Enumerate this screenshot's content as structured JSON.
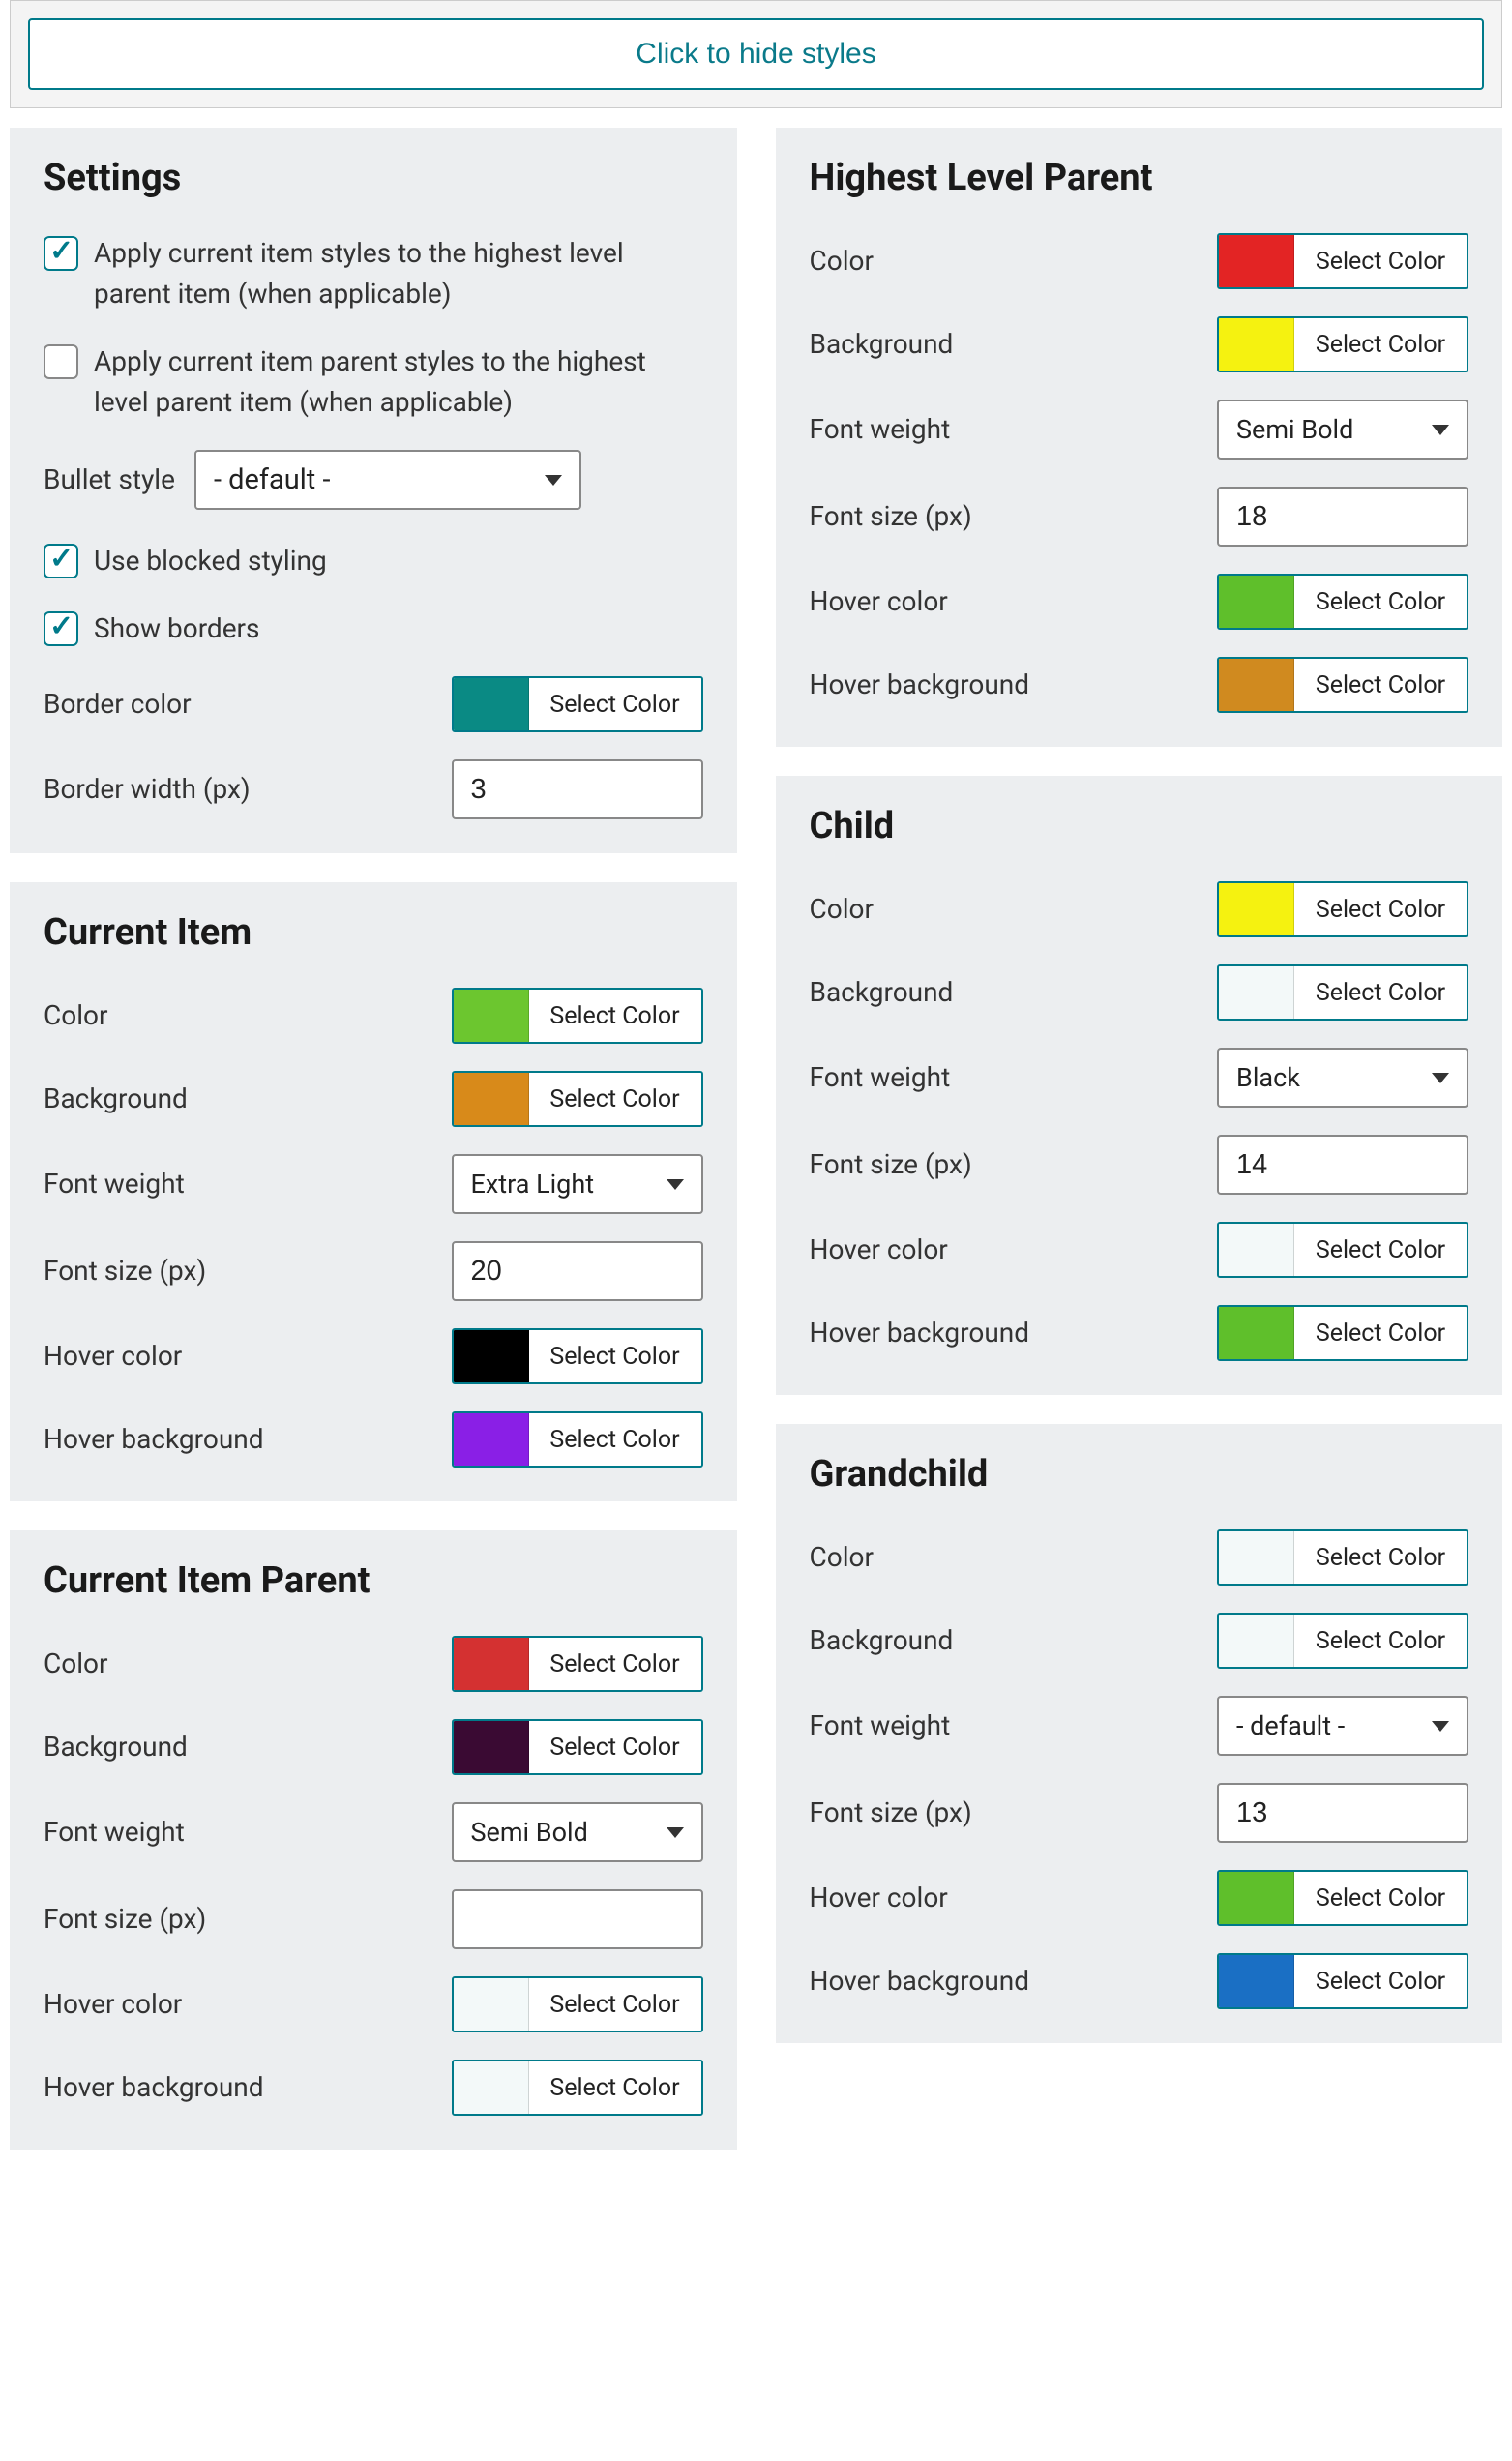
{
  "toggle_label": "Click to hide styles",
  "select_color_label": "Select Color",
  "labels": {
    "color": "Color",
    "background": "Background",
    "font_weight": "Font weight",
    "font_size": "Font size (px)",
    "hover_color": "Hover color",
    "hover_bg": "Hover background"
  },
  "settings": {
    "title": "Settings",
    "apply_current_highest": {
      "label": "Apply current item styles to the highest level parent item (when applicable)",
      "checked": true
    },
    "apply_parent_highest": {
      "label": "Apply current item parent styles to the highest level parent item (when applicable)",
      "checked": false
    },
    "bullet_style": {
      "label": "Bullet style",
      "value": "- default -"
    },
    "use_blocked": {
      "label": "Use blocked styling",
      "checked": true
    },
    "show_borders": {
      "label": "Show borders",
      "checked": true
    },
    "border_color": {
      "label": "Border color",
      "swatch": "#0a8a84"
    },
    "border_width": {
      "label": "Border width (px)",
      "value": "3"
    }
  },
  "current_item": {
    "title": "Current Item",
    "color": "#6cc62f",
    "background": "#d88a1a",
    "font_weight": "Extra Light",
    "font_size": "20",
    "hover_color": "#000000",
    "hover_bg": "#8a1fe6"
  },
  "current_item_parent": {
    "title": "Current Item Parent",
    "color": "#d43131",
    "background": "#3a0a33",
    "font_weight": "Semi Bold",
    "font_size": "",
    "hover_color": "#f3f9f9",
    "hover_bg": "#f3f9f9"
  },
  "highest_level_parent": {
    "title": "Highest Level Parent",
    "color": "#e32424",
    "background": "#f5f210",
    "font_weight": "Semi Bold",
    "font_size": "18",
    "hover_color": "#5fbf2b",
    "hover_bg": "#d08a1f"
  },
  "child": {
    "title": "Child",
    "color": "#f5f210",
    "background": "#f3f9f9",
    "font_weight": "Black",
    "font_size": "14",
    "hover_color": "#f3f9f9",
    "hover_bg": "#5fbf2b"
  },
  "grandchild": {
    "title": "Grandchild",
    "color": "#f3f9f9",
    "background": "#f3f9f9",
    "font_weight": "- default -",
    "font_size": "13",
    "hover_color": "#5fbf2b",
    "hover_bg": "#1a6fc4"
  }
}
